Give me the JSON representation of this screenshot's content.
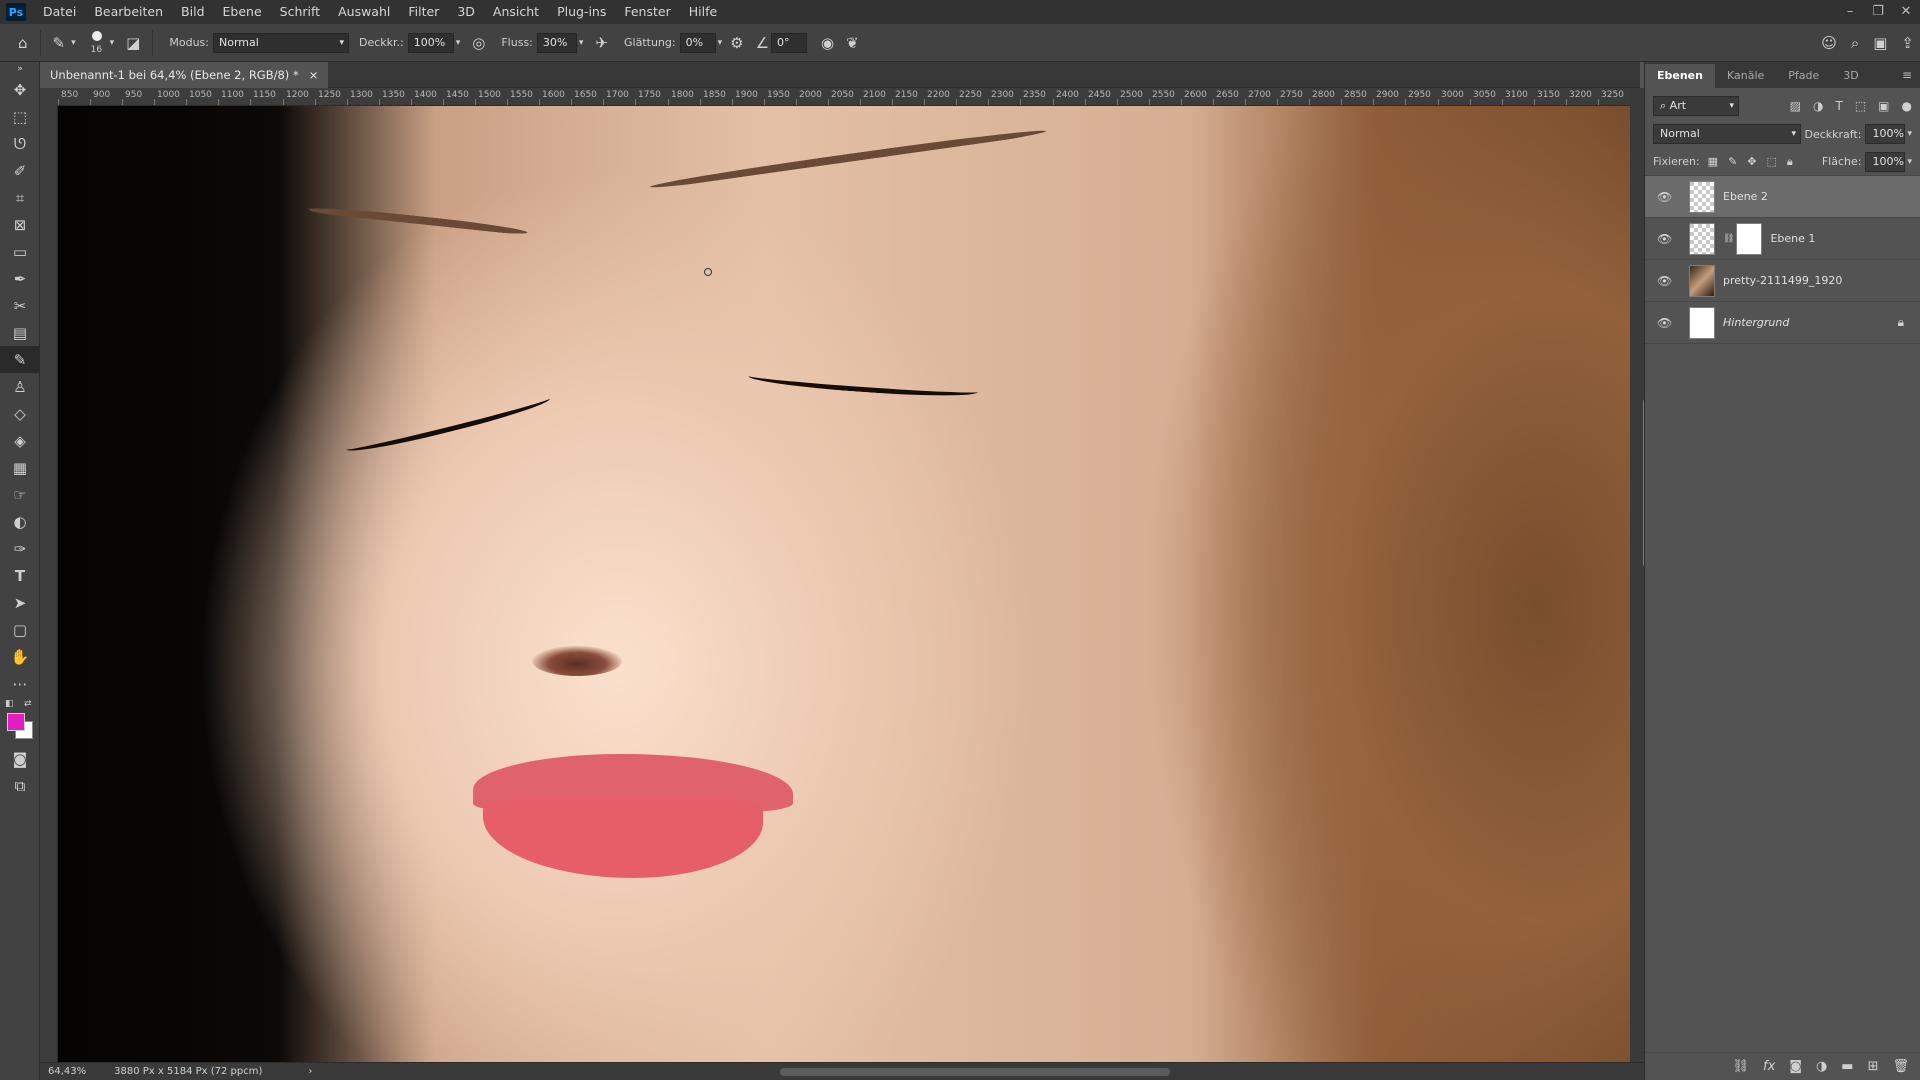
{
  "menu": {
    "logo": "Ps",
    "items": [
      "Datei",
      "Bearbeiten",
      "Bild",
      "Ebene",
      "Schrift",
      "Auswahl",
      "Filter",
      "3D",
      "Ansicht",
      "Plug-ins",
      "Fenster",
      "Hilfe"
    ]
  },
  "window": {
    "minimize": "–",
    "restore": "❐",
    "close": "✕"
  },
  "options": {
    "brush_size": "16",
    "mode_label": "Modus:",
    "mode_value": "Normal",
    "opacity_label": "Deckkr.:",
    "opacity_value": "100%",
    "flow_label": "Fluss:",
    "flow_value": "30%",
    "smoothing_label": "Glättung:",
    "smoothing_value": "0%",
    "angle_value": "0°"
  },
  "document": {
    "tab_title": "Unbenannt-1 bei 64,4% (Ebene 2, RGB/8) *",
    "tab_close": "×"
  },
  "ruler": {
    "h_ticks": [
      "850",
      "900",
      "950",
      "1000",
      "1050",
      "1100",
      "1150",
      "1200",
      "1250",
      "1300",
      "1350",
      "1400",
      "1450",
      "1500",
      "1550",
      "1600",
      "1650",
      "1700",
      "1750",
      "1800",
      "1850",
      "1900",
      "1950",
      "2000",
      "2050",
      "2100",
      "2150",
      "2200",
      "2250",
      "2300",
      "2350",
      "2400",
      "2450",
      "2500",
      "2550",
      "2600",
      "2650",
      "2700",
      "2750",
      "2800",
      "2850",
      "2900",
      "2950",
      "3000",
      "3050",
      "3100",
      "3150",
      "3200",
      "3250"
    ]
  },
  "status": {
    "zoom": "64,43%",
    "doc_size": "3880 Px x 5184 Px (72 ppcm)",
    "arrow": "›"
  },
  "colors": {
    "foreground": "#e21fc2",
    "background": "#ffffff"
  },
  "layers_panel": {
    "tabs": [
      "Ebenen",
      "Kanäle",
      "Pfade",
      "3D"
    ],
    "filter_label": "Art",
    "blend_mode": "Normal",
    "opacity_label": "Deckkraft:",
    "opacity_value": "100%",
    "lock_label": "Fixieren:",
    "fill_label": "Fläche:",
    "fill_value": "100%",
    "layers": [
      {
        "name": "Ebene 2",
        "selected": true
      },
      {
        "name": "Ebene 1",
        "selected": false
      },
      {
        "name": "pretty-2111499_1920",
        "selected": false
      },
      {
        "name": "Hintergrund",
        "selected": false
      }
    ]
  }
}
